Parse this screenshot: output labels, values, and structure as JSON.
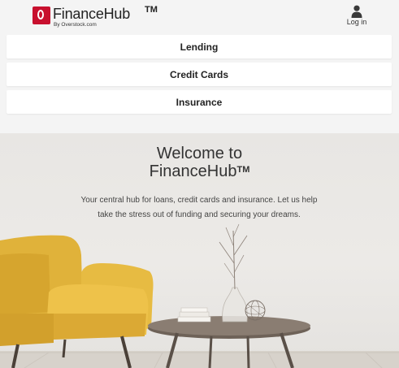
{
  "header": {
    "logo_name": "FinanceHub",
    "logo_tm": "TM",
    "logo_sub": "By Overstock.com",
    "login_label": "Log in",
    "login_icon": "user-icon",
    "brand_color": "#c8102e"
  },
  "nav": {
    "items": [
      {
        "label": "Lending"
      },
      {
        "label": "Credit Cards"
      },
      {
        "label": "Insurance"
      }
    ]
  },
  "hero": {
    "title_line1": "Welcome to",
    "title_line2": "FinanceHub",
    "title_tm": "TM",
    "description": "Your central hub for loans, credit cards and insurance. Let us help take the stress out of funding and securing your dreams."
  }
}
